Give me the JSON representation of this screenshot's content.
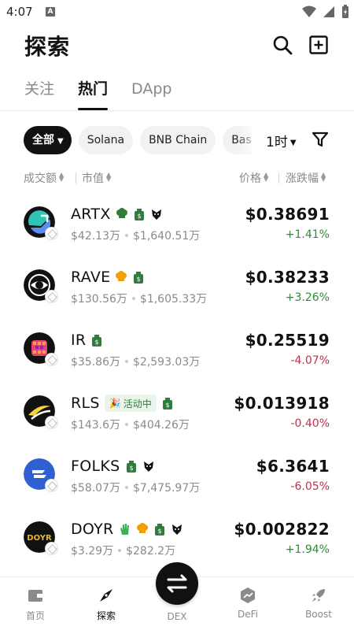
{
  "status": {
    "time": "4:07",
    "notif_glyph": "A"
  },
  "header": {
    "title": "探索",
    "search_icon": "search-icon",
    "add_icon": "add-square-icon"
  },
  "tabs": [
    {
      "label": "关注",
      "active": false
    },
    {
      "label": "热门",
      "active": true
    },
    {
      "label": "DApp",
      "active": false
    }
  ],
  "filters": {
    "chips": [
      "全部",
      "Solana",
      "BNB Chain",
      "Base"
    ],
    "timeframe": "1时",
    "filter_icon": "funnel-icon"
  },
  "sort": {
    "volume": "成交额",
    "market_cap": "市值",
    "price": "价格",
    "change": "涨跌幅"
  },
  "tokens": [
    {
      "symbol": "ARTX",
      "volume": "$42.13万",
      "market_cap": "$1,640.51万",
      "price": "$0.38691",
      "change": "+1.41%",
      "direction": "up",
      "tags": [
        "chef-hat-icon",
        "money-bag-icon",
        "eagle-icon"
      ]
    },
    {
      "symbol": "RAVE",
      "volume": "$130.56万",
      "market_cap": "$1,605.33万",
      "price": "$0.38233",
      "change": "+3.26%",
      "direction": "up",
      "tags": [
        "chef-hat-icon",
        "money-bag-icon"
      ]
    },
    {
      "symbol": "IR",
      "volume": "$35.86万",
      "market_cap": "$2,593.03万",
      "price": "$0.25519",
      "change": "-4.07%",
      "direction": "down",
      "tags": [
        "money-bag-icon"
      ]
    },
    {
      "symbol": "RLS",
      "volume": "$143.6万",
      "market_cap": "$404.26万",
      "price": "$0.013918",
      "change": "-0.40%",
      "direction": "down",
      "activity": "活动中",
      "tags": [
        "money-bag-icon"
      ]
    },
    {
      "symbol": "FOLKS",
      "volume": "$58.07万",
      "market_cap": "$7,475.97万",
      "price": "$6.3641",
      "change": "-6.05%",
      "direction": "down",
      "tags": [
        "money-bag-icon",
        "eagle-icon"
      ]
    },
    {
      "symbol": "DOYR",
      "volume": "$3.29万",
      "market_cap": "$282.2万",
      "price": "$0.002822",
      "change": "+1.94%",
      "direction": "up",
      "avatar_text": "DOYR",
      "tags": [
        "wave-hand-icon",
        "chef-hat-icon",
        "money-bag-icon",
        "eagle-icon"
      ]
    }
  ],
  "nav": {
    "home": "首页",
    "explore": "探索",
    "dex": "DEX",
    "defi": "DeFi",
    "boost": "Boost"
  },
  "colors": {
    "up": "#2e8b3a",
    "down": "#c0304f",
    "accent": "#111111"
  }
}
